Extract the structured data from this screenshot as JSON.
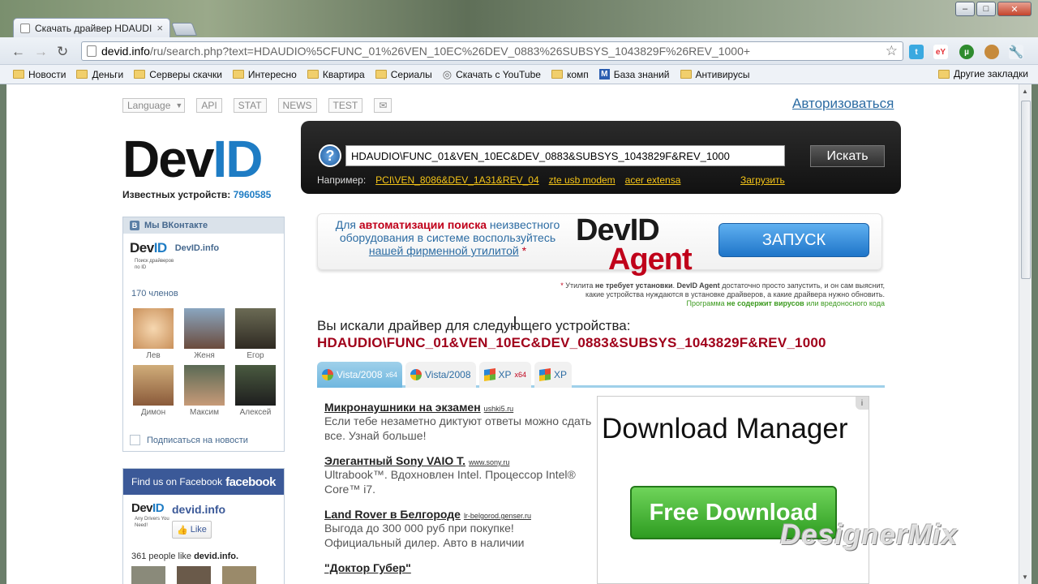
{
  "window": {
    "tab_title": "Скачать драйвер HDAUDIC",
    "minimize": "–",
    "maximize": "□",
    "close": "✕"
  },
  "toolbar": {
    "url_host": "devid.info",
    "url_path": "/ru/search.php?text=HDAUDIO%5CFUNC_01%26VEN_10EC%26DEV_0883%26SUBSYS_1043829F%26REV_1000+",
    "extensions": [
      "twitter-icon",
      "ebay-icon",
      "utorrent-icon",
      "cookie-icon",
      "wrench-icon"
    ]
  },
  "bookmarks": {
    "items": [
      "Новости",
      "Деньги",
      "Серверы скачки",
      "Интересно",
      "Квартира",
      "Сериалы",
      "Скачать с YouTube",
      "комп",
      "База знаний",
      "Антивирусы"
    ],
    "other": "Другие закладки"
  },
  "site": {
    "nav": {
      "language": "Language",
      "api": "API",
      "stat": "STAT",
      "news": "NEWS",
      "test": "TEST",
      "mail_icon": "envelope-icon"
    },
    "login": "Авторизоваться",
    "logo_dev": "Dev",
    "logo_id": "ID",
    "known_label": "Известных устройств:",
    "known_count": "7960585",
    "search": {
      "value": "HDAUDIO\\FUNC_01&VEN_10EC&DEV_0883&SUBSYS_1043829F&REV_1000",
      "button": "Искать",
      "examples_label": "Например:",
      "examples": [
        "PCI\\VEN_8086&DEV_1A31&REV_04",
        "zte usb modem",
        "acer extensa"
      ],
      "upload": "Загрузить"
    }
  },
  "vk": {
    "header": "Мы ВКонтакте",
    "group_logo_dev": "Dev",
    "group_logo_id": "ID",
    "group_name": "DevID.info",
    "group_tagline": "Поиск драйверов по ID",
    "members": "170 членов",
    "people": [
      "Лев",
      "Женя",
      "Егор",
      "Димон",
      "Максим",
      "Алексей"
    ],
    "subscribe": "Подписаться на новости"
  },
  "facebook": {
    "find_us": "Find us on Facebook",
    "brand": "facebook",
    "logo_dev": "Dev",
    "logo_id": "ID",
    "logo_tagline": "Any Drivers You Need!",
    "page_name": "devid.info",
    "like": "Like",
    "count_prefix": "361 people like",
    "count_name": "devid.info."
  },
  "banner": {
    "t1": "Для ",
    "t2": "автоматизации поиска",
    "t3": " неизвестного оборудования в системе воспользуйтесь ",
    "t4": "нашей фирменной утилитой",
    "t5": " *",
    "logo_dev": "Dev",
    "logo_id": "ID",
    "logo_agent": "Agent",
    "launch": "ЗАПУСК"
  },
  "note": {
    "l1a": "* ",
    "l1b": "Утилита ",
    "l1c": "не требует установки",
    "l1d": ". ",
    "l1e": "DevID Agent",
    "l1f": " достаточно просто запустить, и он сам выяснит,",
    "l2": "какие устройства нуждаются в установке драйверов, а какие драйвера нужно обновить.",
    "l3a": "Программа ",
    "l3b": "не содержит вирусов",
    "l3c": " или вредоносного кода"
  },
  "result": {
    "title": "Вы искали драйвер для следующего устройства:",
    "device_id": "HDAUDIO\\FUNC_01&VEN_10EC&DEV_0883&SUBSYS_1043829F&REV_1000"
  },
  "os_tabs": [
    {
      "label": "Vista/2008",
      "sup": "x64"
    },
    {
      "label": "Vista/2008",
      "sup": ""
    },
    {
      "label": "XP",
      "sup": "x64"
    },
    {
      "label": "XP",
      "sup": ""
    }
  ],
  "ads": [
    {
      "title": "Микронаушники на экзамен",
      "domain": "ushki5.ru",
      "text": "Если тебе незаметно диктуют ответы можно сдать все. Узнай больше!"
    },
    {
      "title": "Элегантный Sony VAIO T.",
      "domain": "www.sony.ru",
      "text": "Ultrabook™. Вдохновлен Intel. Процессор Intel® Core™ i7."
    },
    {
      "title": "Land Rover в Белгороде",
      "domain": "lr-belgorod.genser.ru",
      "text": "Выгода до 300 000 руб при покупке! Официальный дилер. Авто в наличии"
    },
    {
      "title": "\"Доктор Губер\"",
      "domain": "",
      "text": ""
    }
  ],
  "download_ad": {
    "title": "Download Manager",
    "button": "Free Download",
    "info": "i"
  },
  "watermark": "DesignerMix"
}
